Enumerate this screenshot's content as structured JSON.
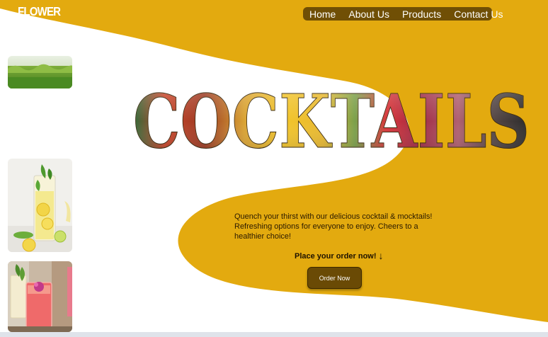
{
  "brand": "FLOWER",
  "nav": {
    "items": [
      {
        "label": "Home"
      },
      {
        "label": "About Us"
      },
      {
        "label": "Products"
      },
      {
        "label": "Contact Us"
      }
    ]
  },
  "hero": {
    "title": "COCKTAILS",
    "description": "Quench your thirst with our delicious cocktail & mocktails! Refreshing options for everyone to enjoy. Cheers to a healthier choice!",
    "cta_text": "Place your order now!",
    "cta_arrow": "↓",
    "order_button": "Order Now"
  },
  "colors": {
    "accent": "#e3aa0f",
    "nav_bg": "#704f05",
    "button_bg": "#6a4a05"
  },
  "images": [
    {
      "name": "grass-field-image"
    },
    {
      "name": "lemon-mojito-image"
    },
    {
      "name": "pink-cocktail-image"
    }
  ]
}
